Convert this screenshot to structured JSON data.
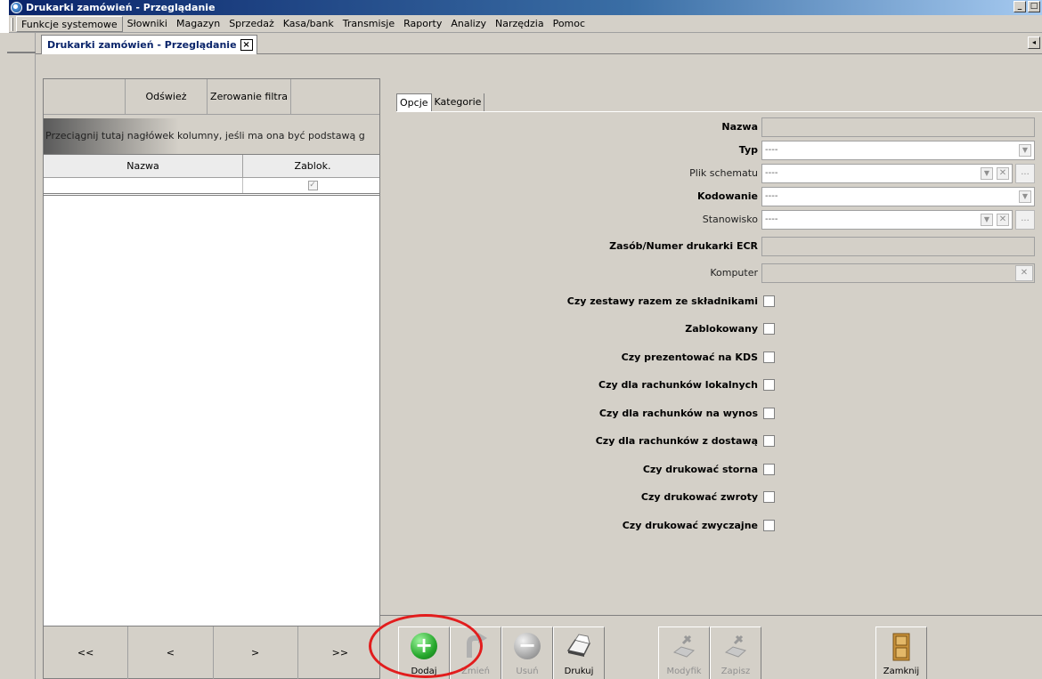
{
  "window": {
    "title": "Drukarki zamówień - Przeglądanie",
    "btn_min": "_",
    "btn_max": "□"
  },
  "menu": {
    "items": [
      {
        "label": "Funkcje systemowe"
      },
      {
        "label": "Słowniki"
      },
      {
        "label": "Magazyn"
      },
      {
        "label": "Sprzedaż"
      },
      {
        "label": "Kasa/bank"
      },
      {
        "label": "Transmisje"
      },
      {
        "label": "Raporty"
      },
      {
        "label": "Analizy"
      },
      {
        "label": "Narzędzia"
      },
      {
        "label": "Pomoc"
      }
    ]
  },
  "doc_tab": {
    "label": "Drukarki zamówień - Przeglądanie",
    "close": "×",
    "scroll": "◂"
  },
  "left": {
    "refresh": "Odśwież",
    "reset_filter": "Zerowanie filtra",
    "group_hint": "Przeciągnij tutaj nagłówek kolumny, jeśli ma ona być podstawą g",
    "columns": {
      "name": "Nazwa",
      "blocked": "Zablok."
    },
    "row_check": "✓",
    "nav": {
      "first": "<<",
      "prev": "<",
      "next": ">",
      "last": ">>"
    }
  },
  "right": {
    "tabs": {
      "options": "Opcje",
      "categories": "Kategorie"
    },
    "fields": {
      "nazwa": "Nazwa",
      "typ": "Typ",
      "typ_value": "----",
      "plik": "Plik schematu",
      "plik_value": "----",
      "kodowanie": "Kodowanie",
      "kodowanie_value": "----",
      "stanowisko": "Stanowisko",
      "stanowisko_value": "----",
      "zasob": "Zasób/Numer drukarki ECR",
      "komputer": "Komputer"
    },
    "checks": {
      "c1": "Czy zestawy razem ze składnikami",
      "c2": "Zablokowany",
      "c3": "Czy prezentować na KDS",
      "c4": "Czy dla rachunków lokalnych",
      "c5": "Czy dla rachunków na wynos",
      "c6": "Czy dla rachunków z dostawą",
      "c7": "Czy drukować storna",
      "c8": "Czy drukować zwroty",
      "c9": "Czy drukować zwyczajne"
    },
    "glyphs": {
      "dd": "▼",
      "x": "✕",
      "dots": "...",
      "plus": "+",
      "minus": "−"
    }
  },
  "toolbar": {
    "dodaj": "Dodaj",
    "zmien": "Zmień",
    "usun": "Usuń",
    "drukuj": "Drukuj",
    "modyfik": "Modyfik",
    "zapisz": "Zapisz",
    "zamknij": "Zamknij"
  },
  "icons": {
    "app": "app-icon",
    "add": "plus-icon",
    "edit": "edit-arrow-icon",
    "delete": "minus-icon",
    "print": "printer-icon",
    "modify": "tools-icon",
    "save": "tools-icon",
    "close": "door-icon"
  },
  "colors": {
    "highlight": "#e21d1d",
    "add_green": "#27a82d",
    "title_blue": "#0a246a"
  }
}
